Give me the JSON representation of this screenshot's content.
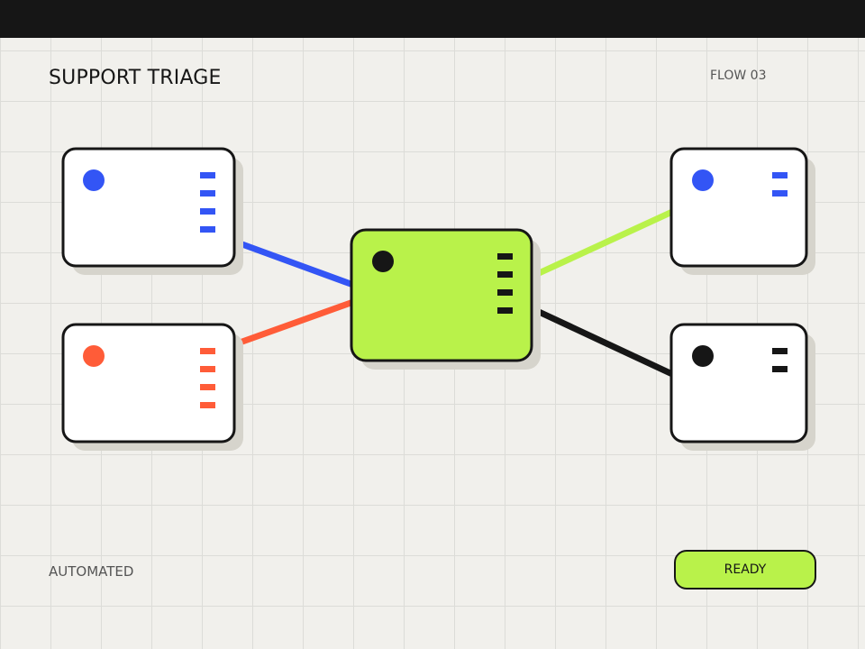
{
  "header": {
    "title": "SUPPORT TRIAGE",
    "flow_label": "FLOW 03"
  },
  "footer": {
    "mode_label": "AUTOMATED",
    "status_button": "READY"
  },
  "colors": {
    "background": "#f1f0ec",
    "grid": "#dcdcd8",
    "ink": "#161616",
    "blue": "#3355f5",
    "orange": "#ff5c38",
    "lime": "#b9f24a",
    "shadow": "#d6d4cc"
  },
  "diagram": {
    "nodes": [
      {
        "id": "input-blue",
        "fill": "white",
        "accent": "blue",
        "ports": 4
      },
      {
        "id": "input-orange",
        "fill": "white",
        "accent": "orange",
        "ports": 4
      },
      {
        "id": "hub",
        "fill": "lime",
        "accent": "ink",
        "ports": 4
      },
      {
        "id": "output-blue",
        "fill": "white",
        "accent": "blue",
        "ports": 2
      },
      {
        "id": "output-black",
        "fill": "white",
        "accent": "ink",
        "ports": 2
      }
    ],
    "edges": [
      {
        "from": "input-blue",
        "to": "hub",
        "color": "blue"
      },
      {
        "from": "input-orange",
        "to": "hub",
        "color": "orange"
      },
      {
        "from": "hub",
        "to": "output-blue",
        "color": "lime"
      },
      {
        "from": "hub",
        "to": "output-black",
        "color": "ink"
      }
    ]
  }
}
